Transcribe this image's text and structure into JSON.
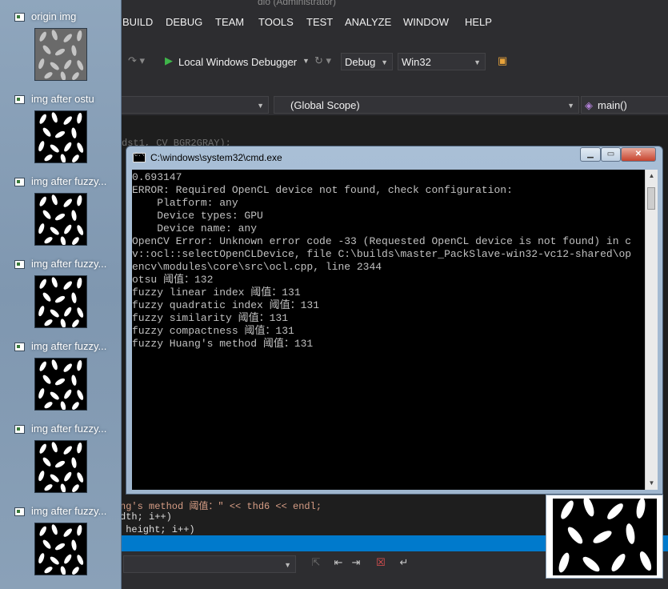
{
  "vs": {
    "title_fragment": "dio (Administrator)",
    "menu": [
      "BUILD",
      "DEBUG",
      "TEAM",
      "TOOLS",
      "TEST",
      "ANALYZE",
      "WINDOW",
      "HELP"
    ],
    "toolbar": {
      "debugger_label": "Local Windows Debugger",
      "config_value": "Debug",
      "platform_value": "Win32"
    },
    "navbar": {
      "scope_value": "(Global Scope)",
      "member_value": "main()"
    },
    "code": {
      "line_top": "dst1, CV_BGR2GRAY);",
      "line_1": "ng's method 阈值：\" << thd6 << endl;",
      "line_2": "dth; i++)",
      "line_3": " height; i++)"
    }
  },
  "thumbnails": [
    {
      "label": "origin img",
      "kind": "gray"
    },
    {
      "label": "img after ostu",
      "kind": "bw"
    },
    {
      "label": "img after fuzzy...",
      "kind": "bw"
    },
    {
      "label": "img after fuzzy...",
      "kind": "bw"
    },
    {
      "label": "img after fuzzy...",
      "kind": "bw"
    },
    {
      "label": "img after fuzzy...",
      "kind": "bw"
    },
    {
      "label": "img after fuzzy...",
      "kind": "bw"
    }
  ],
  "cmd": {
    "title": "C:\\windows\\system32\\cmd.exe",
    "lines": [
      "0.693147",
      "ERROR: Required OpenCL device not found, check configuration:",
      "    Platform: any",
      "    Device types: GPU",
      "    Device name: any",
      "OpenCV Error: Unknown error code -33 (Requested OpenCL device is not found) in c",
      "v::ocl::selectOpenCLDevice, file C:\\builds\\master_PackSlave-win32-vc12-shared\\op",
      "encv\\modules\\core\\src\\ocl.cpp, line 2344",
      "otsu 阈值：132",
      "fuzzy linear index 阈值：131",
      "fuzzy quadratic index 阈值：131",
      "fuzzy similarity 阈值：131",
      "fuzzy compactness 阈值：131",
      "fuzzy Huang's method 阈值：131"
    ]
  },
  "colors": {
    "vs_bg": "#2d2d30",
    "editor_bg": "#1e1e1e",
    "statusbar": "#007acc",
    "cmd_text": "#c0c0c0"
  }
}
